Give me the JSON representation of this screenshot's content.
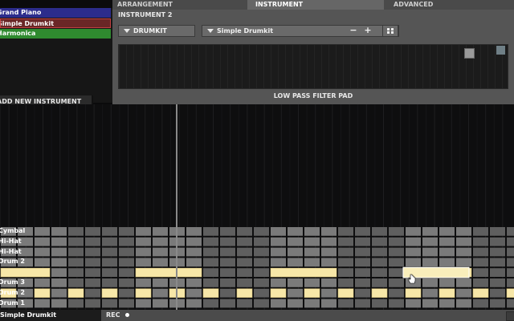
{
  "instrument_list": {
    "items": [
      {
        "label": "Grand Piano",
        "color": "#2c2c8c"
      },
      {
        "label": "Simple Drumkit",
        "color": "#5a2020",
        "selected": true
      },
      {
        "label": "Harmonica",
        "color": "#2f8a2f"
      }
    ],
    "add_button": "ADD NEW INSTRUMENT"
  },
  "tabs": [
    {
      "label": "ARRANGEMENT"
    },
    {
      "label": "INSTRUMENT",
      "active": true
    },
    {
      "label": "ADVANCED"
    }
  ],
  "panel": {
    "title": "INSTRUMENT 2",
    "type_select": "DRUMKIT",
    "preset_select": "Simple Drumkit",
    "minus": "−",
    "plus": "+",
    "grid_icon": "grid-icon",
    "pad_label": "LOW PASS FILTER PAD"
  },
  "sequencer": {
    "rows": [
      {
        "label": "Cymbal",
        "cells": "................................"
      },
      {
        "label": "Hi-Hat",
        "cells": "................................"
      },
      {
        "label": "Hi-Hat",
        "cells": "................................"
      },
      {
        "label": "Drum 2",
        "cells": "................................"
      },
      {
        "label": "",
        "cells": "AA..AA..AA..AA....................",
        "notes": [
          [
            0,
            2
          ],
          [
            8,
            11
          ],
          [
            16,
            19
          ],
          [
            24,
            27
          ]
        ]
      },
      {
        "label": "Drum 3",
        "cells": "................................"
      },
      {
        "label": "Drum 2",
        "cells": "",
        "notes": [
          [
            0,
            0
          ],
          [
            2,
            2
          ],
          [
            4,
            4
          ],
          [
            6,
            6
          ],
          [
            8,
            8
          ],
          [
            10,
            10
          ],
          [
            12,
            12
          ],
          [
            14,
            14
          ],
          [
            16,
            16
          ],
          [
            18,
            18
          ],
          [
            20,
            20
          ],
          [
            22,
            22
          ],
          [
            24,
            24
          ],
          [
            26,
            26
          ],
          [
            28,
            28
          ],
          [
            30,
            30
          ]
        ]
      },
      {
        "label": "Drum 1",
        "cells": "................................"
      }
    ],
    "colors": {
      "cell": "#7a7a7a",
      "cell_alt": "#5f5f5f",
      "note": "#f7e7a8",
      "note_edge": "#d6c27e",
      "highlight": "#3a3a3a"
    },
    "playhead_step": 10,
    "hover_note_step": 24
  },
  "status": {
    "instrument": "Simple Drumkit",
    "rec_label": "REC"
  }
}
